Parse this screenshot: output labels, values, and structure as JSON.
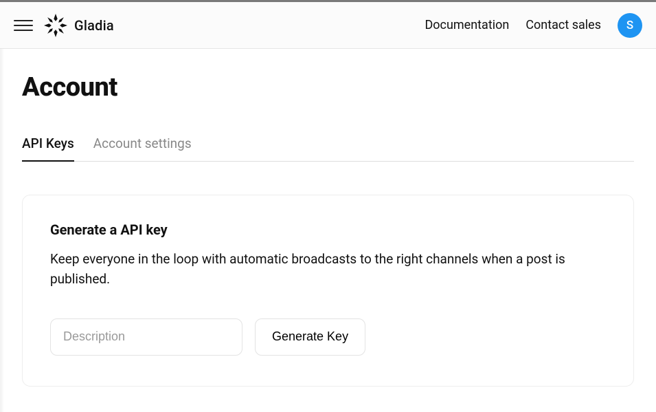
{
  "header": {
    "brand_name": "Gladia",
    "nav": {
      "documentation": "Documentation",
      "contact_sales": "Contact sales"
    },
    "avatar_initial": "S"
  },
  "page": {
    "title": "Account"
  },
  "tabs": {
    "api_keys": "API Keys",
    "account_settings": "Account settings"
  },
  "generate_card": {
    "title": "Generate a API key",
    "description": "Keep everyone in the loop with automatic broadcasts to the right channels when a post is published.",
    "description_input_placeholder": "Description",
    "generate_button_label": "Generate Key"
  }
}
